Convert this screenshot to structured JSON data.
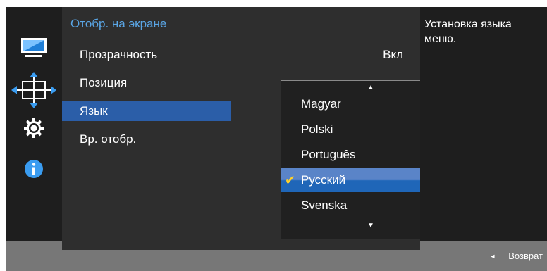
{
  "menu": {
    "title": "Отобр. на экране",
    "items": [
      {
        "label": "Прозрачность",
        "value": "Вкл"
      },
      {
        "label": "Позиция"
      },
      {
        "label": "Язык"
      },
      {
        "label": "Вр. отобр."
      }
    ],
    "selected_index": 2
  },
  "language_list": {
    "options": [
      "Magyar",
      "Polski",
      "Português",
      "Русский",
      "Svenska"
    ],
    "selected": "Русский"
  },
  "help": {
    "text": "Установка языка меню."
  },
  "footer": {
    "back_label": "Возврат"
  },
  "colors": {
    "title": "#5aa6e6",
    "selection": "#2b5ea8",
    "checkmark": "#ffd12a"
  },
  "icons": [
    "monitor-icon",
    "position-arrows-icon",
    "gear-icon",
    "info-icon"
  ]
}
